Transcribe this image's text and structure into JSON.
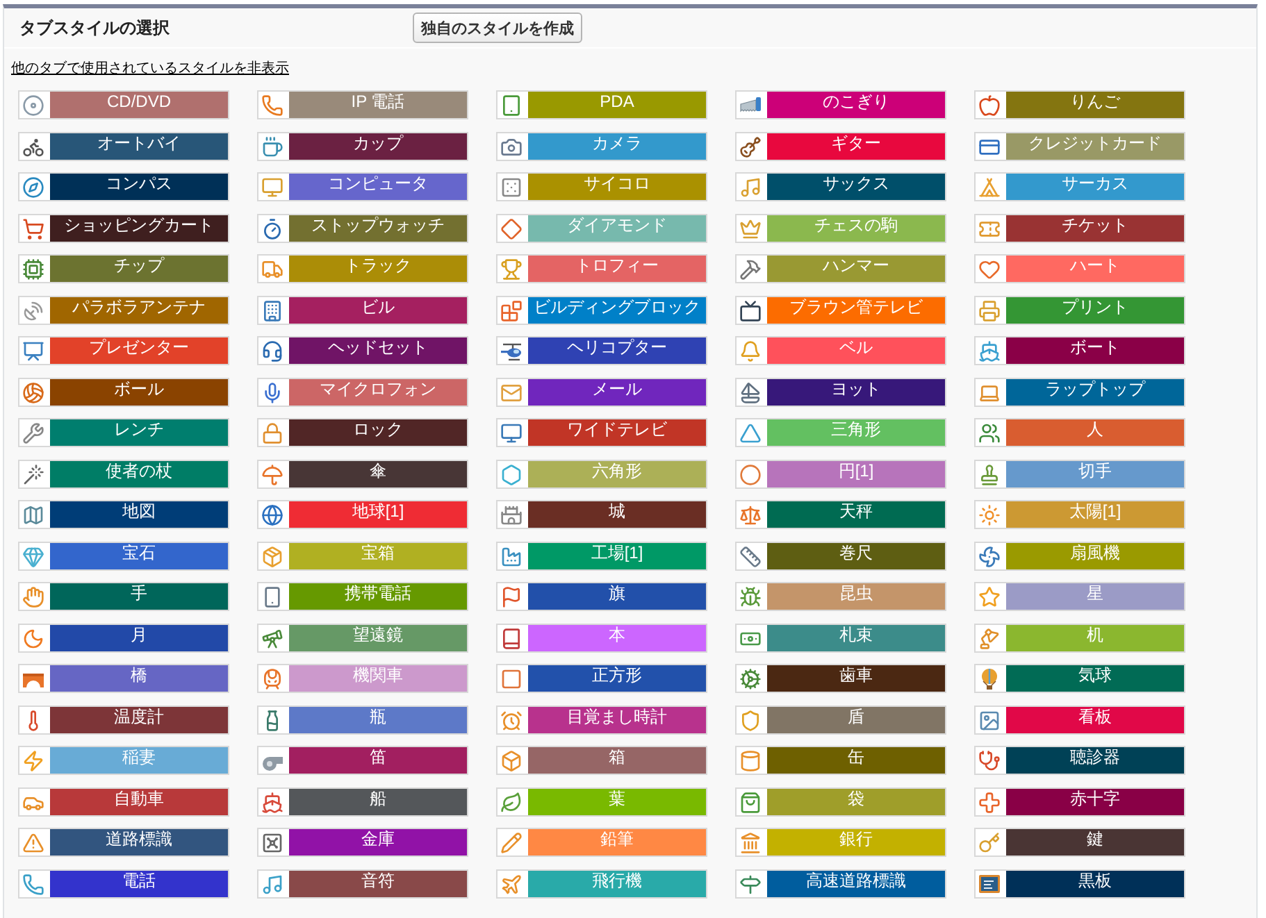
{
  "header": {
    "title": "タブスタイルの選択",
    "create_button": "独自のスタイルを作成"
  },
  "hide_used_link": "他のタブで使用されているスタイルを非表示",
  "styles": [
    {
      "label": "CD/DVD",
      "color": "#b0706e"
    },
    {
      "label": "IP 電話",
      "color": "#998a7a"
    },
    {
      "label": "PDA",
      "color": "#999900"
    },
    {
      "label": "のこぎり",
      "color": "#cc0078"
    },
    {
      "label": "りんご",
      "color": "#847510"
    },
    {
      "label": "オートバイ",
      "color": "#285678"
    },
    {
      "label": "カップ",
      "color": "#6b2142"
    },
    {
      "label": "カメラ",
      "color": "#3399cc"
    },
    {
      "label": "ギター",
      "color": "#e8083e"
    },
    {
      "label": "クレジットカード",
      "color": "#999966"
    },
    {
      "label": "コンパス",
      "color": "#003057"
    },
    {
      "label": "コンピュータ",
      "color": "#6666cc"
    },
    {
      "label": "サイコロ",
      "color": "#aa9100"
    },
    {
      "label": "サックス",
      "color": "#004f6a"
    },
    {
      "label": "サーカス",
      "color": "#3399cd"
    },
    {
      "label": "ショッピングカート",
      "color": "#3f1f1f"
    },
    {
      "label": "ストップウォッチ",
      "color": "#737030"
    },
    {
      "label": "ダイアモンド",
      "color": "#77b9ad"
    },
    {
      "label": "チェスの駒",
      "color": "#8bb84e"
    },
    {
      "label": "チケット",
      "color": "#993333"
    },
    {
      "label": "チップ",
      "color": "#6c7330"
    },
    {
      "label": "トラック",
      "color": "#ab8d07"
    },
    {
      "label": "トロフィー",
      "color": "#e46464"
    },
    {
      "label": "ハンマー",
      "color": "#999933"
    },
    {
      "label": "ハート",
      "color": "#ff6961"
    },
    {
      "label": "パラボラアンテナ",
      "color": "#a06600"
    },
    {
      "label": "ビル",
      "color": "#a52060"
    },
    {
      "label": "ビルディングブロック",
      "color": "#0080c8"
    },
    {
      "label": "ブラウン管テレビ",
      "color": "#fc6c00"
    },
    {
      "label": "プリント",
      "color": "#349634"
    },
    {
      "label": "プレゼンター",
      "color": "#e24229"
    },
    {
      "label": "ヘッドセット",
      "color": "#701466"
    },
    {
      "label": "ヘリコプター",
      "color": "#2f42b3"
    },
    {
      "label": "ベル",
      "color": "#ff515b"
    },
    {
      "label": "ボート",
      "color": "#8a0047"
    },
    {
      "label": "ボール",
      "color": "#8a4300"
    },
    {
      "label": "マイクロフォン",
      "color": "#cc6666"
    },
    {
      "label": "メール",
      "color": "#7026bd"
    },
    {
      "label": "ヨット",
      "color": "#37187a"
    },
    {
      "label": "ラップトップ",
      "color": "#006699"
    },
    {
      "label": "レンチ",
      "color": "#007e6e"
    },
    {
      "label": "ロック",
      "color": "#512626"
    },
    {
      "label": "ワイドテレビ",
      "color": "#c13526"
    },
    {
      "label": "三角形",
      "color": "#63c061"
    },
    {
      "label": "人",
      "color": "#d95d30"
    },
    {
      "label": "使者の杖",
      "color": "#007d66"
    },
    {
      "label": "傘",
      "color": "#483636"
    },
    {
      "label": "六角形",
      "color": "#acb057"
    },
    {
      "label": "円[1]",
      "color": "#b774bb"
    },
    {
      "label": "切手",
      "color": "#6699cc"
    },
    {
      "label": "地図",
      "color": "#003d77"
    },
    {
      "label": "地球[1]",
      "color": "#ef2c34"
    },
    {
      "label": "城",
      "color": "#6a2e24"
    },
    {
      "label": "天秤",
      "color": "#006b52"
    },
    {
      "label": "太陽[1]",
      "color": "#cc9933"
    },
    {
      "label": "宝石",
      "color": "#3366cc"
    },
    {
      "label": "宝箱",
      "color": "#b0b022"
    },
    {
      "label": "工場[1]",
      "color": "#009966"
    },
    {
      "label": "巻尺",
      "color": "#5e5e12"
    },
    {
      "label": "扇風機",
      "color": "#9a9a00"
    },
    {
      "label": "手",
      "color": "#00665a"
    },
    {
      "label": "携帯電話",
      "color": "#669900"
    },
    {
      "label": "旗",
      "color": "#2250aa"
    },
    {
      "label": "昆虫",
      "color": "#c4956a"
    },
    {
      "label": "星",
      "color": "#9b9bc6"
    },
    {
      "label": "月",
      "color": "#2249a8"
    },
    {
      "label": "望遠鏡",
      "color": "#669966"
    },
    {
      "label": "本",
      "color": "#cc66ff"
    },
    {
      "label": "札束",
      "color": "#3c8c8a"
    },
    {
      "label": "机",
      "color": "#8bb72f"
    },
    {
      "label": "橋",
      "color": "#6666c4"
    },
    {
      "label": "機関車",
      "color": "#cc99cc"
    },
    {
      "label": "正方形",
      "color": "#2251ab"
    },
    {
      "label": "歯車",
      "color": "#4b2812"
    },
    {
      "label": "気球",
      "color": "#016b55"
    },
    {
      "label": "温度計",
      "color": "#7d3538"
    },
    {
      "label": "瓶",
      "color": "#5d79c8"
    },
    {
      "label": "目覚まし時計",
      "color": "#b8328d"
    },
    {
      "label": "盾",
      "color": "#817565"
    },
    {
      "label": "看板",
      "color": "#e10848"
    },
    {
      "label": "稲妻",
      "color": "#68abd6"
    },
    {
      "label": "笛",
      "color": "#a21f60"
    },
    {
      "label": "箱",
      "color": "#966666"
    },
    {
      "label": "缶",
      "color": "#6e6000"
    },
    {
      "label": "聴診器",
      "color": "#004156"
    },
    {
      "label": "自動車",
      "color": "#b8393a"
    },
    {
      "label": "船",
      "color": "#54575a"
    },
    {
      "label": "葉",
      "color": "#79b900"
    },
    {
      "label": "袋",
      "color": "#9f9e2a"
    },
    {
      "label": "赤十字",
      "color": "#890046"
    },
    {
      "label": "道路標識",
      "color": "#32557f"
    },
    {
      "label": "金庫",
      "color": "#9112a7"
    },
    {
      "label": "鉛筆",
      "color": "#ff8844"
    },
    {
      "label": "銀行",
      "color": "#c3b100"
    },
    {
      "label": "鍵",
      "color": "#4a3534"
    },
    {
      "label": "電話",
      "color": "#3333cc"
    },
    {
      "label": "音符",
      "color": "#894949"
    },
    {
      "label": "飛行機",
      "color": "#29aaa9"
    },
    {
      "label": "高速道路標識",
      "color": "#005d9e"
    },
    {
      "label": "黒板",
      "color": "#003058"
    }
  ]
}
